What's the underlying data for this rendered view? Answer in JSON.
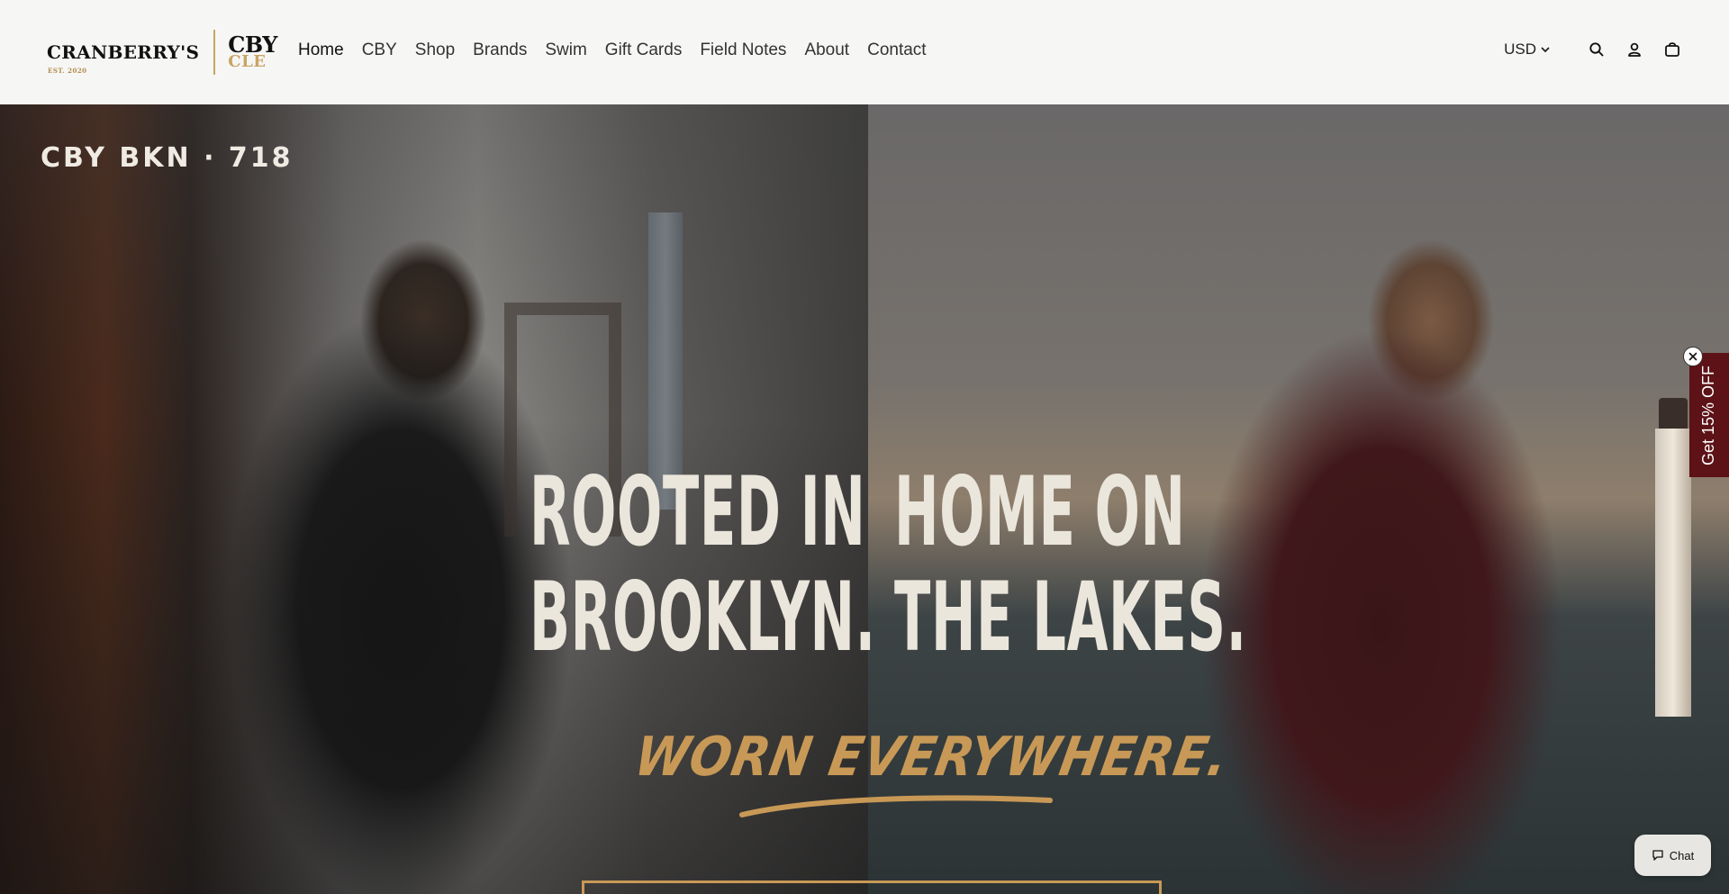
{
  "header": {
    "logo": {
      "brand_name": "CRANBERRY'S",
      "est": "EST. 2020",
      "sub_top": "CBY",
      "sub_bottom": "CLE"
    },
    "nav": [
      "Home",
      "CBY",
      "Shop",
      "Brands",
      "Swim",
      "Gift Cards",
      "Field Notes",
      "About",
      "Contact"
    ],
    "active_nav": "Home",
    "currency": "USD",
    "icons": [
      "search-icon",
      "account-icon",
      "cart-icon"
    ]
  },
  "hero": {
    "tag": "CBY BKN · 718",
    "headline_left": [
      "ROOTED IN",
      "BROOKLYN."
    ],
    "headline_right": [
      "HOME ON",
      "THE LAKES."
    ],
    "tagline": "WORN EVERYWHERE.",
    "colors": {
      "headline": "#ebe6dc",
      "accent": "#c89956"
    }
  },
  "discount_tab": {
    "label": "Get 15% OFF",
    "color": "#5c1216"
  },
  "chat": {
    "label": "Chat"
  }
}
